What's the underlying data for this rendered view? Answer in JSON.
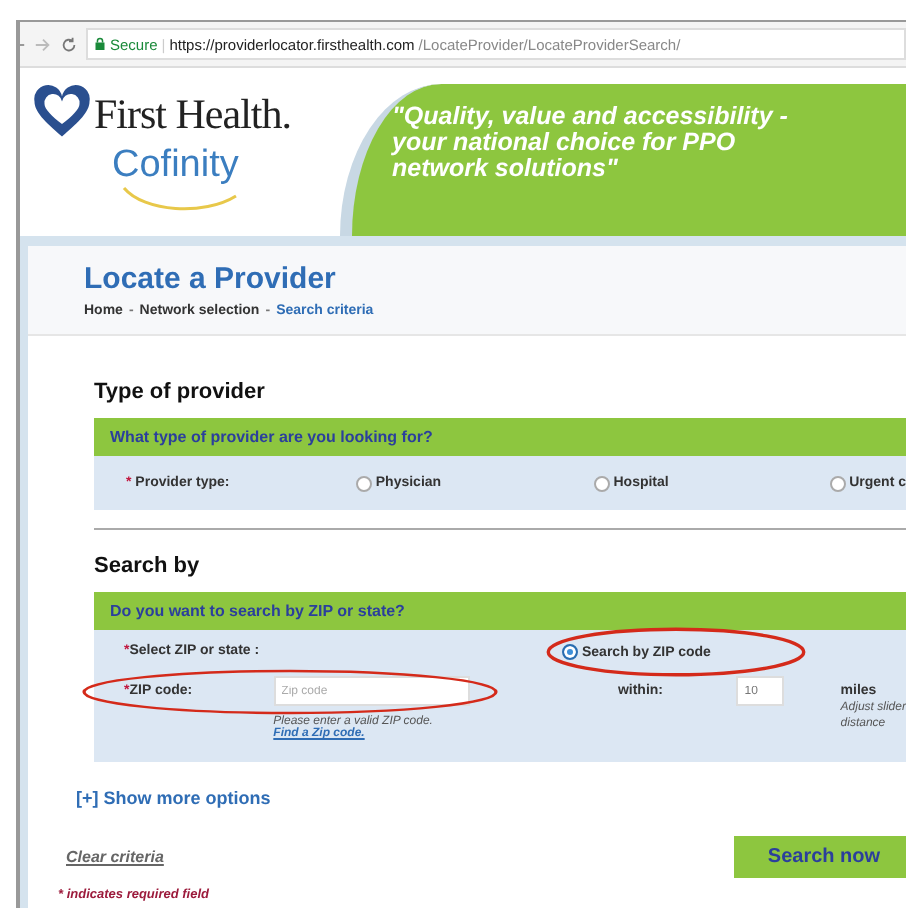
{
  "browser": {
    "secure_label": "Secure",
    "divider": "|",
    "url_host": "https://providerlocator.firsthealth.com",
    "url_path": "/LocateProvider/LocateProviderSearch/"
  },
  "header": {
    "brand": "First Health.",
    "sub_brand": "Cofinity",
    "tagline": "\"Quality, value and accessibility - your national choice for PPO network solutions\""
  },
  "page": {
    "title": "Locate a Provider",
    "breadcrumb_separator": "-",
    "breadcrumb": [
      {
        "label": "Home",
        "selected": false
      },
      {
        "label": "Network selection",
        "selected": false
      },
      {
        "label": "Search criteria",
        "selected": true
      }
    ]
  },
  "provider_section": {
    "heading": "Type of provider",
    "question": "What type of provider are you looking for?",
    "required_mark": "*",
    "label": "Provider type:",
    "options": [
      {
        "label": "Physician",
        "selected": false
      },
      {
        "label": "Hospital",
        "selected": false
      },
      {
        "label": "Urgent c",
        "selected": false
      }
    ]
  },
  "search_section": {
    "heading": "Search by",
    "question": "Do you want to search by ZIP or state?",
    "select_label_mark": "*",
    "select_label": "Select ZIP or state :",
    "option": {
      "label": "Search by ZIP code",
      "selected": true
    },
    "zip_mark": "*",
    "zip_label": "ZIP code:",
    "zip_placeholder": "Zip code",
    "zip_hint": "Please enter a valid ZIP code.",
    "zip_link": "Find a Zip code.",
    "within_label": "within:",
    "within_value": "10",
    "miles_label": "miles",
    "slider_hint_1": "Adjust slider",
    "slider_hint_2": "distance"
  },
  "more_options": "[+] Show more options",
  "clear_link": "Clear criteria",
  "search_button": "Search now",
  "required_note": "* indicates required field"
}
